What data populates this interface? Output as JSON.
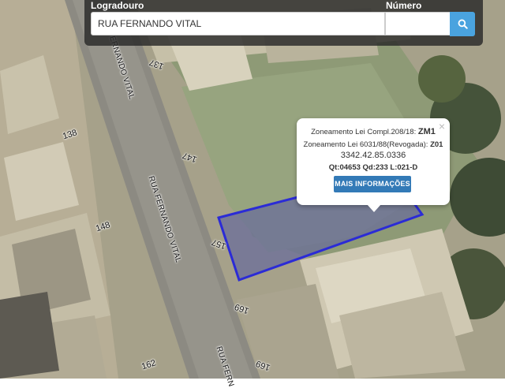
{
  "search": {
    "street_label": "Logradouro",
    "street_value": "RUA FERNANDO VITAL",
    "number_label": "Número",
    "number_value": ""
  },
  "popup": {
    "zoning_law_label": "Zoneamento Lei Compl.208/18:",
    "zoning_law_value": "ZM1",
    "zoning_old_label": "Zoneamento Lei 6031/88(Revogada):",
    "zoning_old_value": "Z01",
    "parcel_code": "3342.42.85.0336",
    "lot_info": "Qt:04653 Qd:233 L:021-D",
    "more_info_label": "MAIS INFORMAÇÕES",
    "close_glyph": "×"
  },
  "map": {
    "street_labels": [
      "RUA FERNANDO VITAL",
      "RUA FERNANDO VITAL",
      "RUA FERN"
    ],
    "house_numbers": [
      "137",
      "138",
      "147",
      "148",
      "157",
      "169",
      "162",
      "169"
    ],
    "parcel_outline_color": "#2b2bd6"
  }
}
